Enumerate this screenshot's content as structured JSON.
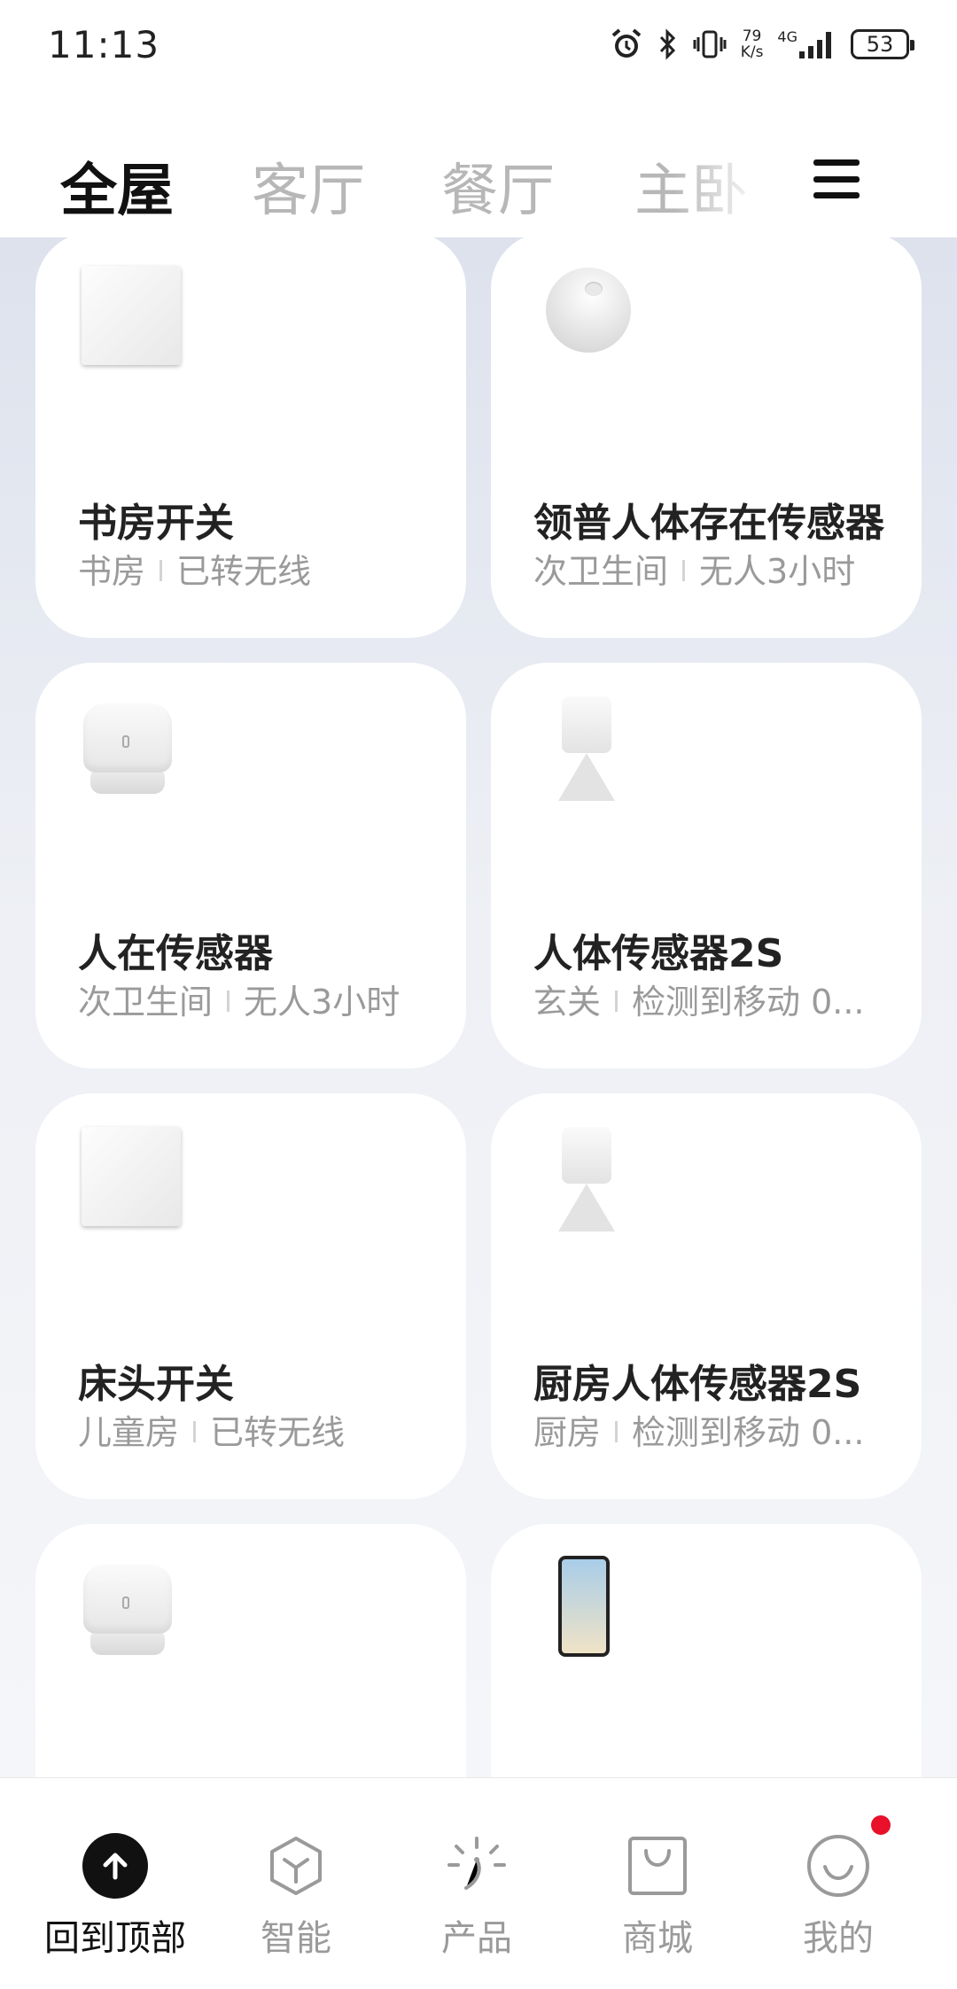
{
  "status_bar": {
    "time": "11:13",
    "net_speed_value": "79",
    "net_speed_unit": "K/s",
    "network_type": "4G",
    "battery_level": "53"
  },
  "room_tabs": [
    {
      "label": "全屋",
      "active": true
    },
    {
      "label": "客厅",
      "active": false
    },
    {
      "label": "餐厅",
      "active": false
    },
    {
      "label": "主卧",
      "active": false
    }
  ],
  "devices": [
    {
      "name": "书房开关",
      "room": "书房",
      "status": "已转无线",
      "icon": "wall-switch"
    },
    {
      "name": "领普人体存在传感器",
      "room": "次卫生间",
      "status": "无人3小时",
      "icon": "presence-sensor-dome"
    },
    {
      "name": "人在传感器",
      "room": "次卫生间",
      "status": "无人3小时",
      "icon": "presence-sensor-cylinder"
    },
    {
      "name": "人体传感器2S",
      "room": "玄关",
      "status": "检测到移动 0...",
      "icon": "motion-sensor"
    },
    {
      "name": "床头开关",
      "room": "儿童房",
      "status": "已转无线",
      "icon": "wall-switch"
    },
    {
      "name": "厨房人体传感器2S",
      "room": "厨房",
      "status": "检测到移动 0...",
      "icon": "motion-sensor"
    },
    {
      "name": "",
      "room": "",
      "status": "",
      "icon": "presence-sensor-cylinder"
    },
    {
      "name": "",
      "room": "",
      "status": "",
      "icon": "phone"
    }
  ],
  "bottom_nav": [
    {
      "label": "回到顶部",
      "icon": "arrow-up-icon",
      "active": true
    },
    {
      "label": "智能",
      "icon": "smart-cube-icon",
      "active": false
    },
    {
      "label": "产品",
      "icon": "product-spark-icon",
      "active": false
    },
    {
      "label": "商城",
      "icon": "shopping-bag-icon",
      "active": false
    },
    {
      "label": "我的",
      "icon": "profile-smile-icon",
      "active": false,
      "badge": true
    }
  ],
  "colors": {
    "badge": "#e8102a",
    "active_text": "#111111",
    "inactive_text": "#9a9a9a"
  }
}
